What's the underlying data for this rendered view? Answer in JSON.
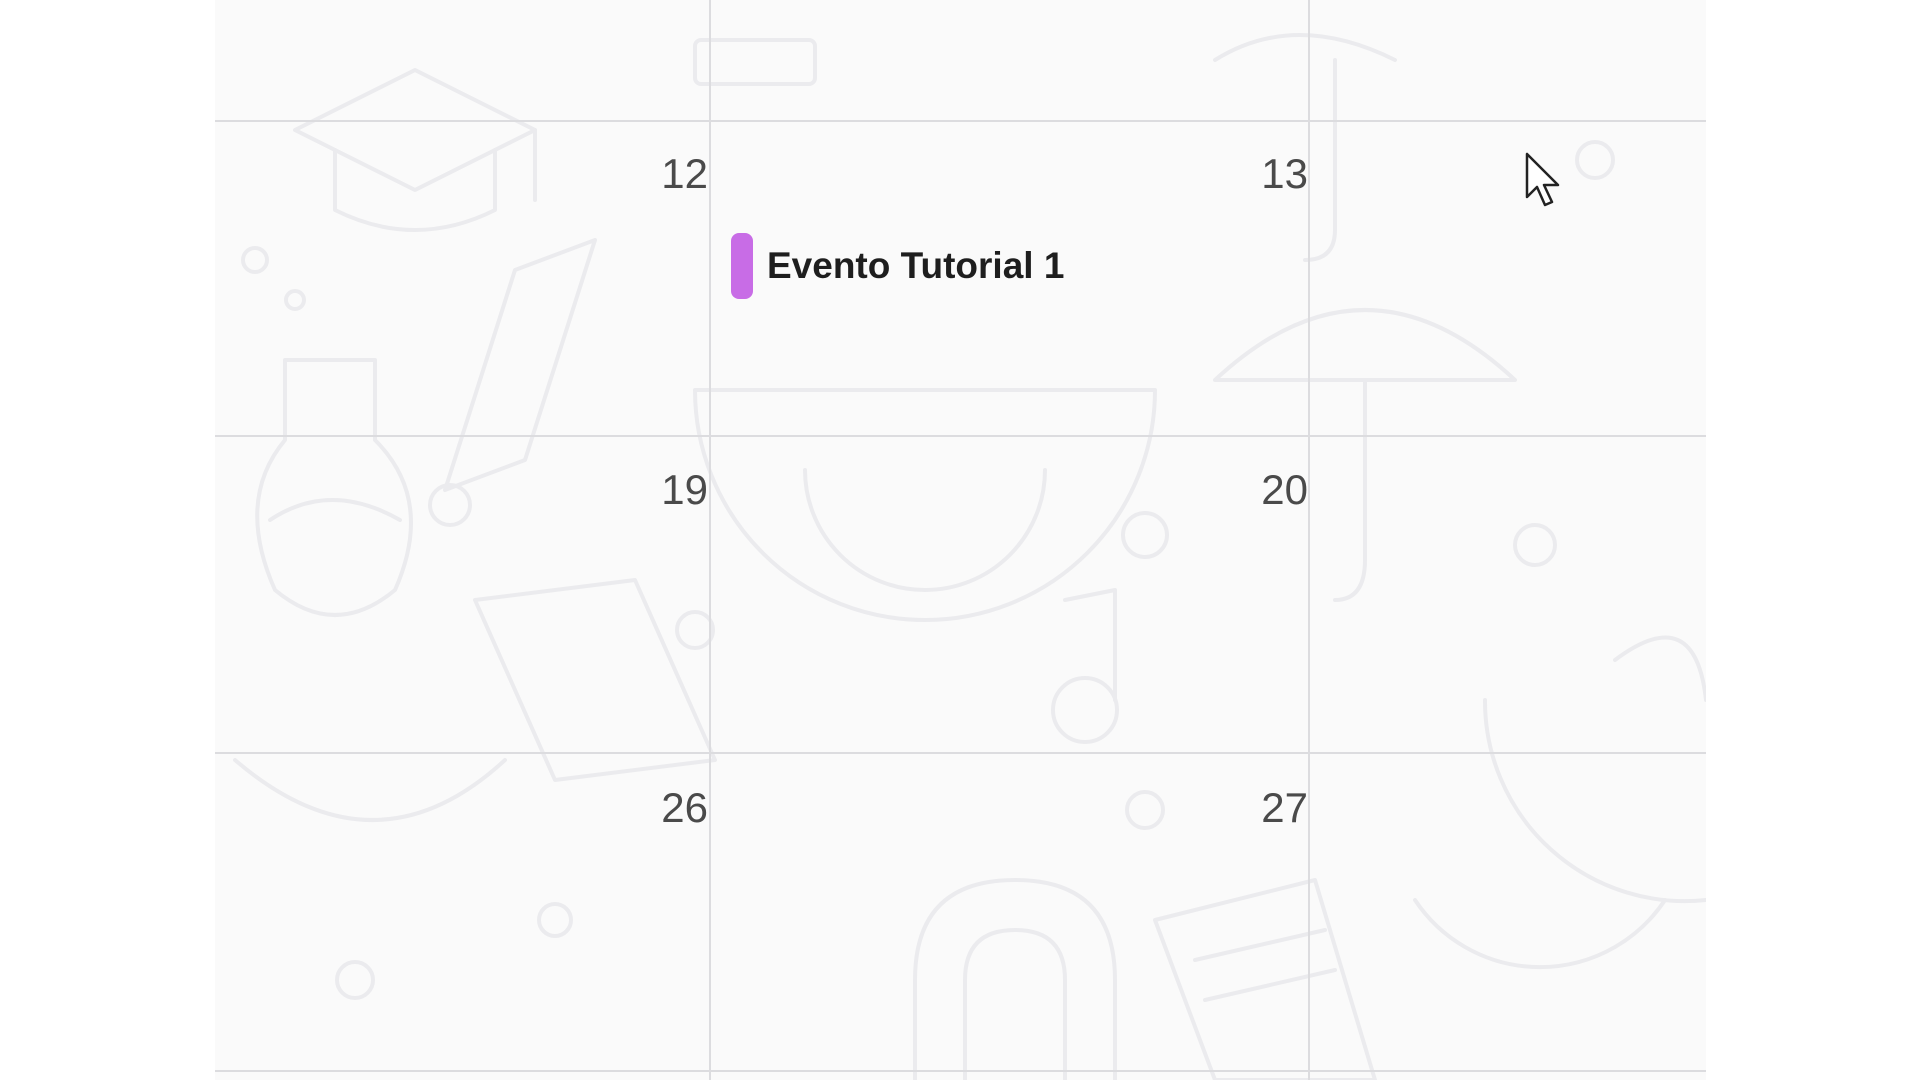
{
  "calendar": {
    "rows": [
      {
        "days": [
          "12",
          "13"
        ]
      },
      {
        "days": [
          "19",
          "20"
        ]
      },
      {
        "days": [
          "26",
          "27"
        ]
      }
    ],
    "event": {
      "title": "Evento Tutorial 1",
      "color": "#c86ce6"
    }
  },
  "cursor": {
    "icon": "mouse-pointer-icon"
  }
}
